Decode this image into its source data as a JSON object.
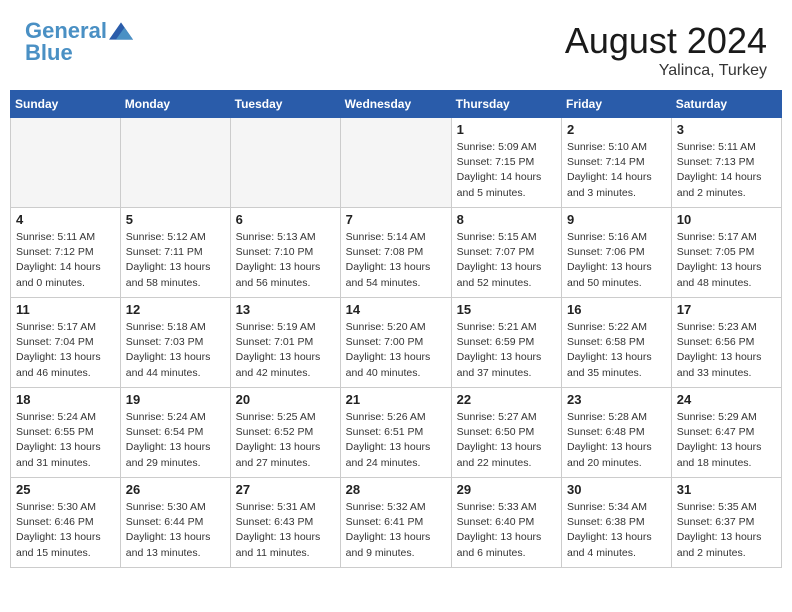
{
  "header": {
    "logo_line1": "General",
    "logo_line2": "Blue",
    "month_year": "August 2024",
    "location": "Yalinca, Turkey"
  },
  "weekdays": [
    "Sunday",
    "Monday",
    "Tuesday",
    "Wednesday",
    "Thursday",
    "Friday",
    "Saturday"
  ],
  "weeks": [
    [
      {
        "day": "",
        "info": ""
      },
      {
        "day": "",
        "info": ""
      },
      {
        "day": "",
        "info": ""
      },
      {
        "day": "",
        "info": ""
      },
      {
        "day": "1",
        "info": "Sunrise: 5:09 AM\nSunset: 7:15 PM\nDaylight: 14 hours\nand 5 minutes."
      },
      {
        "day": "2",
        "info": "Sunrise: 5:10 AM\nSunset: 7:14 PM\nDaylight: 14 hours\nand 3 minutes."
      },
      {
        "day": "3",
        "info": "Sunrise: 5:11 AM\nSunset: 7:13 PM\nDaylight: 14 hours\nand 2 minutes."
      }
    ],
    [
      {
        "day": "4",
        "info": "Sunrise: 5:11 AM\nSunset: 7:12 PM\nDaylight: 14 hours\nand 0 minutes."
      },
      {
        "day": "5",
        "info": "Sunrise: 5:12 AM\nSunset: 7:11 PM\nDaylight: 13 hours\nand 58 minutes."
      },
      {
        "day": "6",
        "info": "Sunrise: 5:13 AM\nSunset: 7:10 PM\nDaylight: 13 hours\nand 56 minutes."
      },
      {
        "day": "7",
        "info": "Sunrise: 5:14 AM\nSunset: 7:08 PM\nDaylight: 13 hours\nand 54 minutes."
      },
      {
        "day": "8",
        "info": "Sunrise: 5:15 AM\nSunset: 7:07 PM\nDaylight: 13 hours\nand 52 minutes."
      },
      {
        "day": "9",
        "info": "Sunrise: 5:16 AM\nSunset: 7:06 PM\nDaylight: 13 hours\nand 50 minutes."
      },
      {
        "day": "10",
        "info": "Sunrise: 5:17 AM\nSunset: 7:05 PM\nDaylight: 13 hours\nand 48 minutes."
      }
    ],
    [
      {
        "day": "11",
        "info": "Sunrise: 5:17 AM\nSunset: 7:04 PM\nDaylight: 13 hours\nand 46 minutes."
      },
      {
        "day": "12",
        "info": "Sunrise: 5:18 AM\nSunset: 7:03 PM\nDaylight: 13 hours\nand 44 minutes."
      },
      {
        "day": "13",
        "info": "Sunrise: 5:19 AM\nSunset: 7:01 PM\nDaylight: 13 hours\nand 42 minutes."
      },
      {
        "day": "14",
        "info": "Sunrise: 5:20 AM\nSunset: 7:00 PM\nDaylight: 13 hours\nand 40 minutes."
      },
      {
        "day": "15",
        "info": "Sunrise: 5:21 AM\nSunset: 6:59 PM\nDaylight: 13 hours\nand 37 minutes."
      },
      {
        "day": "16",
        "info": "Sunrise: 5:22 AM\nSunset: 6:58 PM\nDaylight: 13 hours\nand 35 minutes."
      },
      {
        "day": "17",
        "info": "Sunrise: 5:23 AM\nSunset: 6:56 PM\nDaylight: 13 hours\nand 33 minutes."
      }
    ],
    [
      {
        "day": "18",
        "info": "Sunrise: 5:24 AM\nSunset: 6:55 PM\nDaylight: 13 hours\nand 31 minutes."
      },
      {
        "day": "19",
        "info": "Sunrise: 5:24 AM\nSunset: 6:54 PM\nDaylight: 13 hours\nand 29 minutes."
      },
      {
        "day": "20",
        "info": "Sunrise: 5:25 AM\nSunset: 6:52 PM\nDaylight: 13 hours\nand 27 minutes."
      },
      {
        "day": "21",
        "info": "Sunrise: 5:26 AM\nSunset: 6:51 PM\nDaylight: 13 hours\nand 24 minutes."
      },
      {
        "day": "22",
        "info": "Sunrise: 5:27 AM\nSunset: 6:50 PM\nDaylight: 13 hours\nand 22 minutes."
      },
      {
        "day": "23",
        "info": "Sunrise: 5:28 AM\nSunset: 6:48 PM\nDaylight: 13 hours\nand 20 minutes."
      },
      {
        "day": "24",
        "info": "Sunrise: 5:29 AM\nSunset: 6:47 PM\nDaylight: 13 hours\nand 18 minutes."
      }
    ],
    [
      {
        "day": "25",
        "info": "Sunrise: 5:30 AM\nSunset: 6:46 PM\nDaylight: 13 hours\nand 15 minutes."
      },
      {
        "day": "26",
        "info": "Sunrise: 5:30 AM\nSunset: 6:44 PM\nDaylight: 13 hours\nand 13 minutes."
      },
      {
        "day": "27",
        "info": "Sunrise: 5:31 AM\nSunset: 6:43 PM\nDaylight: 13 hours\nand 11 minutes."
      },
      {
        "day": "28",
        "info": "Sunrise: 5:32 AM\nSunset: 6:41 PM\nDaylight: 13 hours\nand 9 minutes."
      },
      {
        "day": "29",
        "info": "Sunrise: 5:33 AM\nSunset: 6:40 PM\nDaylight: 13 hours\nand 6 minutes."
      },
      {
        "day": "30",
        "info": "Sunrise: 5:34 AM\nSunset: 6:38 PM\nDaylight: 13 hours\nand 4 minutes."
      },
      {
        "day": "31",
        "info": "Sunrise: 5:35 AM\nSunset: 6:37 PM\nDaylight: 13 hours\nand 2 minutes."
      }
    ]
  ]
}
